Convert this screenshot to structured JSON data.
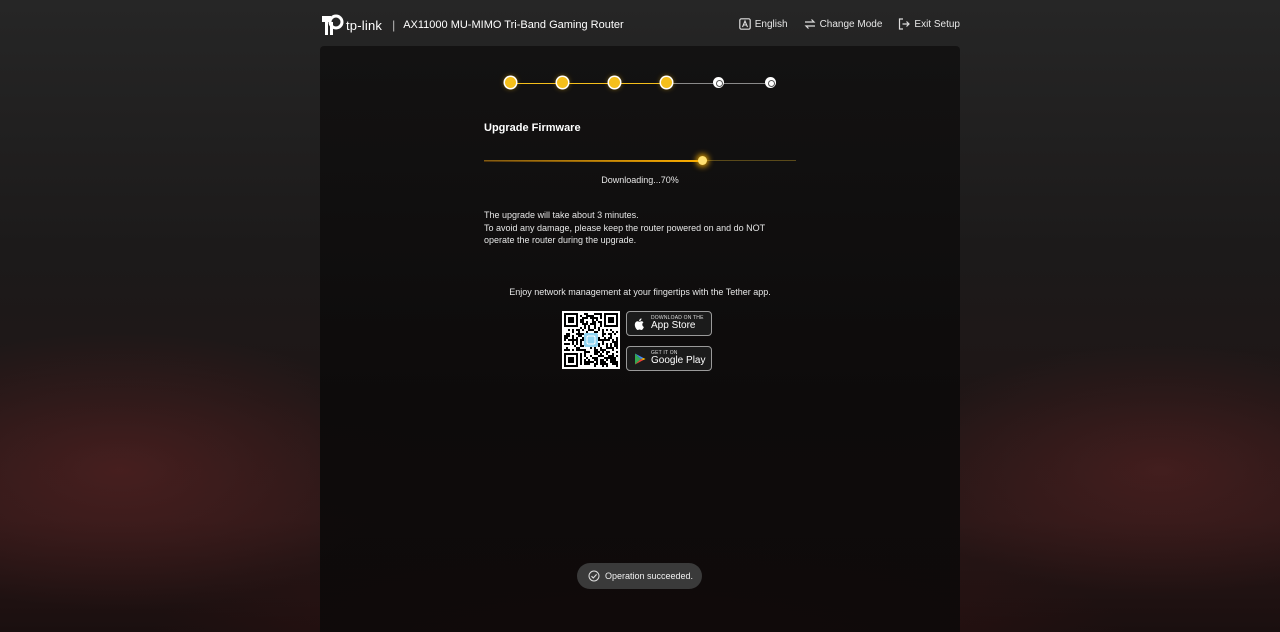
{
  "header": {
    "brand": "tp-link",
    "separator": "|",
    "model": "AX11000 MU-MIMO Tri-Band Gaming Router",
    "nav": {
      "language": "English",
      "change_mode": "Change Mode",
      "exit_setup": "Exit Setup"
    }
  },
  "stepper": {
    "total_steps": 6,
    "completed_steps": 4,
    "active_color": "#f5bf1b",
    "inactive_color": "#ffffff"
  },
  "upgrade": {
    "title": "Upgrade Firmware",
    "progress_percent": 70,
    "progress_text": "Downloading...70%",
    "notes": [
      "The upgrade will take about 3 minutes.",
      "To avoid any damage, please keep the router powered on and do NOT operate the router during the upgrade."
    ]
  },
  "tether": {
    "message": "Enjoy network management at your fingertips with the Tether app.",
    "app_store": {
      "small": "Download on the",
      "big": "App Store",
      "icon": "apple-icon"
    },
    "google_play": {
      "small": "GET IT ON",
      "big": "Google Play",
      "icon": "google-play-icon"
    }
  },
  "toast": {
    "message": "Operation succeeded.",
    "icon": "check-circle-icon"
  },
  "colors": {
    "accent": "#ffb000",
    "toast_bg": "#3a3a3a"
  }
}
